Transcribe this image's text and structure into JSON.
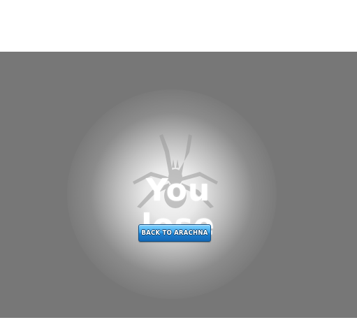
{
  "game": {
    "result_text": "You lose",
    "back_button_label": "BACK TO ARACHNA",
    "background_color": "#777777",
    "button_color": "#2f92e0",
    "emblem_icon": "spider-icon"
  }
}
